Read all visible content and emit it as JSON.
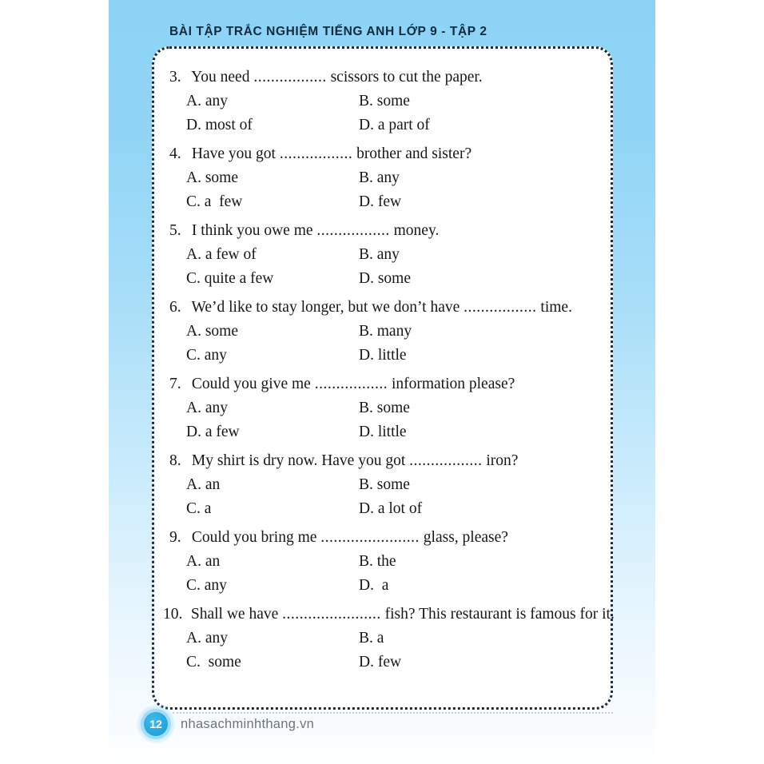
{
  "page": {
    "running_header": "BÀI TẬP TRẮC NGHIỆM TIẾNG ANH LỚP 9 - TẬP 2",
    "background_top_color": "#8cd3f6",
    "background_bottom_color": "#fdfeff",
    "frame_border_color": "#17293a",
    "frame_fill_color": "#ffffff",
    "text_color": "#171717"
  },
  "footer": {
    "page_number": "12",
    "badge_color": "#24a7e0",
    "badge_glow_color": "#a4dcf7",
    "site": "nhasachminhthang.vn",
    "site_color": "#6d7379"
  },
  "questions": [
    {
      "number": "3.",
      "stem_before": " You need ",
      "blank": ".................",
      "stem_after": " scissors to cut the paper.",
      "options": [
        {
          "a": "A. any",
          "b": "B. some"
        },
        {
          "a": "D. most of",
          "b": "D. a part of"
        }
      ]
    },
    {
      "number": "4.",
      "stem_before": " Have you got ",
      "blank": ".................",
      "stem_after": " brother and sister?",
      "options": [
        {
          "a": "A. some",
          "b": "B. any"
        },
        {
          "a": "C. a  few",
          "b": "D. few"
        }
      ]
    },
    {
      "number": "5.",
      "stem_before": " I think you owe me ",
      "blank": ".................",
      "stem_after": " money.",
      "options": [
        {
          "a": "A. a few of",
          "b": "B. any"
        },
        {
          "a": "C. quite a few",
          "b": "D. some"
        }
      ]
    },
    {
      "number": "6.",
      "stem_before": " We’d like to stay longer, but we don’t have ",
      "blank": ".................",
      "stem_after": " time.",
      "options": [
        {
          "a": "A. some",
          "b": "B. many"
        },
        {
          "a": "C. any",
          "b": "D. little"
        }
      ]
    },
    {
      "number": "7.",
      "stem_before": " Could you give me ",
      "blank": ".................",
      "stem_after": " information please?",
      "options": [
        {
          "a": "A. any",
          "b": "B. some"
        },
        {
          "a": "D. a few",
          "b": "D. little"
        }
      ]
    },
    {
      "number": "8.",
      "stem_before": " My shirt is dry now. Have you got ",
      "blank": ".................",
      "stem_after": " iron?",
      "options": [
        {
          "a": "A. an",
          "b": "B. some"
        },
        {
          "a": "C. a",
          "b": "D. a lot of"
        }
      ]
    },
    {
      "number": "9.",
      "stem_before": " Could you bring me ",
      "blank": ".......................",
      "stem_after": " glass, please?",
      "options": [
        {
          "a": "A. an",
          "b": "B. the"
        },
        {
          "a": "C. any",
          "b": "D.  a"
        }
      ]
    },
    {
      "number": "10.",
      "stem_before": " Shall we have ",
      "blank": ".......................",
      "stem_after": " fish? This restaurant is famous for it.",
      "options": [
        {
          "a": "A. any",
          "b": "B. a"
        },
        {
          "a": "C.  some",
          "b": "D. few"
        }
      ]
    }
  ]
}
